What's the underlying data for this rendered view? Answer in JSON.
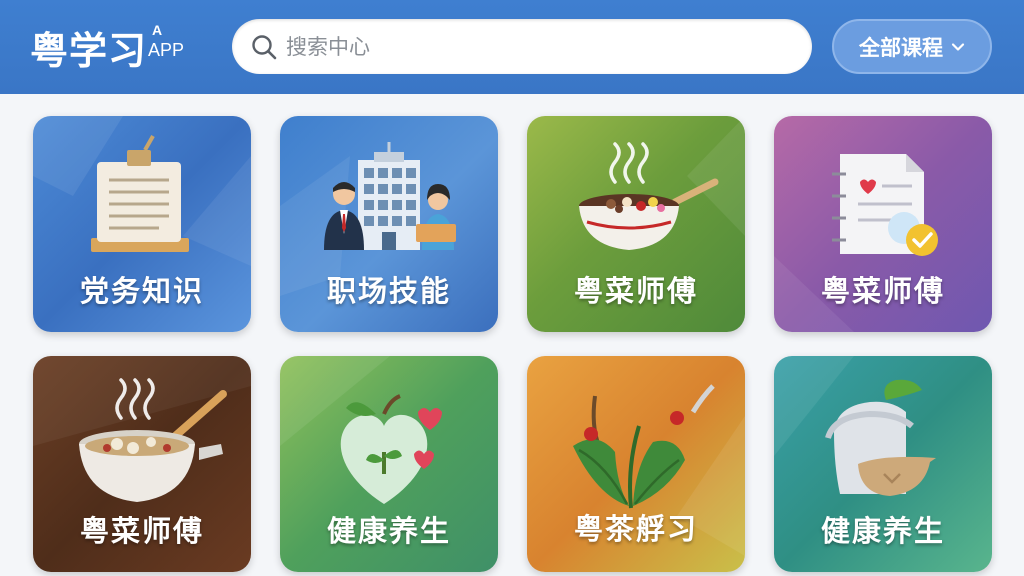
{
  "header": {
    "logo_text": "粤学习",
    "logo_sup": "A",
    "logo_app": "APP",
    "search": {
      "placeholder": "搜索中心"
    },
    "filter": {
      "label": "全部课程",
      "icon": "chevron-down-icon"
    }
  },
  "tiles": [
    {
      "label": "党务知识",
      "icon": "document-board-icon",
      "color": "#4c8ad6"
    },
    {
      "label": "职场技能",
      "icon": "office-building-icon",
      "color": "#3f7fcd"
    },
    {
      "label": "粤菜师傅",
      "icon": "steaming-bowl-icon",
      "color": "#6c9d3c"
    },
    {
      "label": "粤菜师傅",
      "icon": "checklist-icon",
      "color": "#8a5aa8"
    },
    {
      "label": "粤菜师傅",
      "icon": "cooking-pot-icon",
      "color": "#4f2d1a"
    },
    {
      "label": "健康养生",
      "icon": "apple-heart-icon",
      "color": "#4fa05c"
    },
    {
      "label": "粤茶艀习",
      "icon": "tea-leaves-icon",
      "color": "#d8832f"
    },
    {
      "label": "健康养生",
      "icon": "bowl-lid-icon",
      "color": "#2f8f84"
    }
  ]
}
